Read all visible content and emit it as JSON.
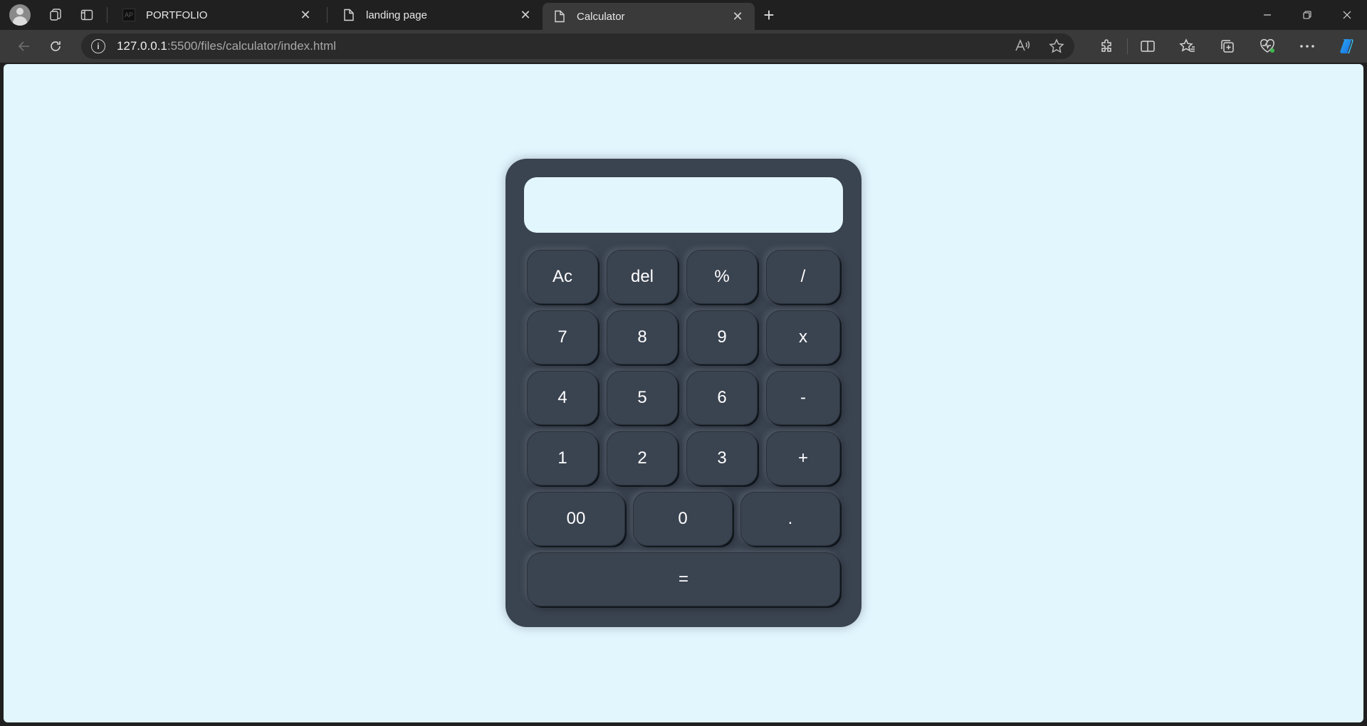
{
  "browser": {
    "tabs": [
      {
        "title": "PORTFOLIO",
        "favicon": "ap-logo-icon",
        "active": false
      },
      {
        "title": "landing page",
        "favicon": "page-icon",
        "active": false
      },
      {
        "title": "Calculator",
        "favicon": "page-icon",
        "active": true
      }
    ],
    "address": {
      "host": "127.0.0.1",
      "rest": ":5500/files/calculator/index.html"
    }
  },
  "calculator": {
    "display_value": "",
    "rows": [
      [
        "Ac",
        "del",
        "%",
        "/"
      ],
      [
        "7",
        "8",
        "9",
        "x"
      ],
      [
        "4",
        "5",
        "6",
        "-"
      ],
      [
        "1",
        "2",
        "3",
        "+"
      ],
      [
        "00",
        "0",
        "."
      ],
      [
        "="
      ]
    ]
  },
  "colors": {
    "page_background": "#e2f6fe",
    "calculator_body": "#3a4350",
    "button_text": "#ffffff"
  }
}
